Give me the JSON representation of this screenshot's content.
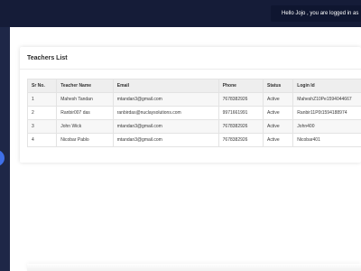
{
  "header": {
    "greeting": "Hello Jojo , you are logged in as"
  },
  "teachers": {
    "title": "Teachers List",
    "columns": [
      "Sr No.",
      "Teacher Name",
      "Email",
      "Phone",
      "Status",
      "Login Id"
    ],
    "rows": [
      [
        "1",
        "Mahesh Tandan",
        "mtandan3@gmail.com",
        "7678382926",
        "Active",
        "MaheshZ10Pe1594044667"
      ],
      [
        "2",
        "Ranbir007 das",
        "ranbirdas@nuclaysolutions.com",
        "9971661991",
        "Active",
        "Ranbir11P0t1594188974"
      ],
      [
        "3",
        "John Wick",
        "mtandan3@gmail.com",
        "7678382926",
        "Active",
        "John400"
      ],
      [
        "4",
        "Nicobar Pablo",
        "mtandan3@gmail.com",
        "7678382926",
        "Active",
        "Nicobar401"
      ]
    ]
  }
}
